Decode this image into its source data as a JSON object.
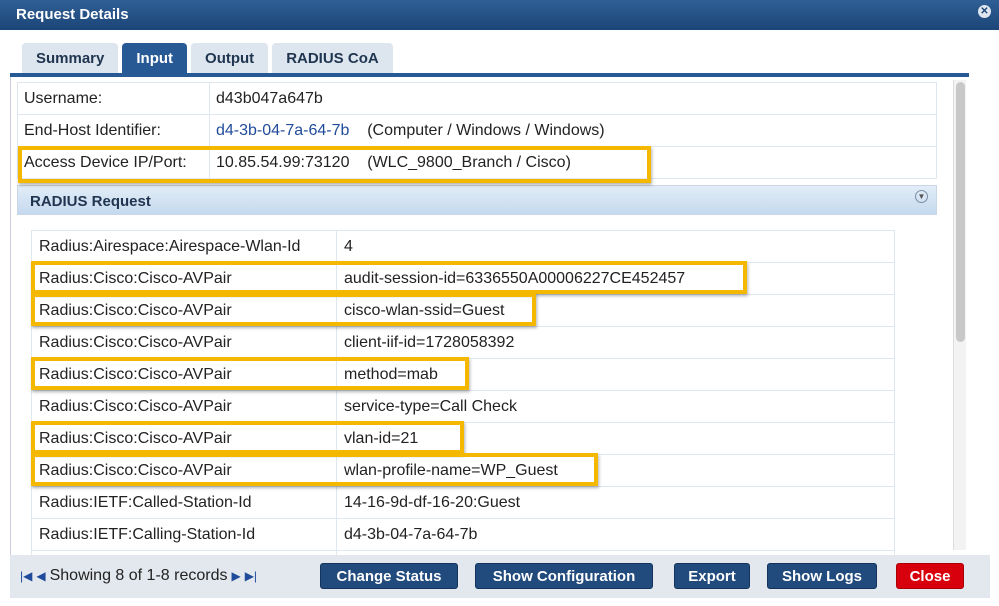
{
  "title": "Request Details",
  "tabs": [
    "Summary",
    "Input",
    "Output",
    "RADIUS CoA"
  ],
  "active_tab": "Input",
  "info": [
    {
      "label": "Username:",
      "value": "d43b047a647b",
      "extra": ""
    },
    {
      "label": "End-Host Identifier:",
      "value": "d4-3b-04-7a-64-7b",
      "extra": "(Computer / Windows / Windows)"
    },
    {
      "label": "Access Device IP/Port:",
      "value": "10.85.54.99:73120",
      "extra": "(WLC_9800_Branch / Cisco)"
    }
  ],
  "radius_header": "RADIUS Request",
  "radius": [
    {
      "attr": "Radius:Airespace:Airespace-Wlan-Id",
      "value": "4"
    },
    {
      "attr": "Radius:Cisco:Cisco-AVPair",
      "value": "audit-session-id=6336550A00006227CE452457"
    },
    {
      "attr": "Radius:Cisco:Cisco-AVPair",
      "value": "cisco-wlan-ssid=Guest"
    },
    {
      "attr": "Radius:Cisco:Cisco-AVPair",
      "value": "client-iif-id=1728058392"
    },
    {
      "attr": "Radius:Cisco:Cisco-AVPair",
      "value": "method=mab"
    },
    {
      "attr": "Radius:Cisco:Cisco-AVPair",
      "value": "service-type=Call Check"
    },
    {
      "attr": "Radius:Cisco:Cisco-AVPair",
      "value": "vlan-id=21"
    },
    {
      "attr": "Radius:Cisco:Cisco-AVPair",
      "value": "wlan-profile-name=WP_Guest"
    },
    {
      "attr": "Radius:IETF:Called-Station-Id",
      "value": "14-16-9d-df-16-20:Guest"
    },
    {
      "attr": "Radius:IETF:Calling-Station-Id",
      "value": "d4-3b-04-7a-64-7b"
    },
    {
      "attr": "",
      "value": ""
    }
  ],
  "footer": {
    "pager": "Showing 8 of 1-8 records",
    "buttons": [
      "Change Status",
      "Show Configuration",
      "Export",
      "Show Logs",
      "Close"
    ]
  },
  "colors": {
    "highlight": "#f5b800",
    "accent": "#275a94",
    "close": "#d9000d"
  }
}
